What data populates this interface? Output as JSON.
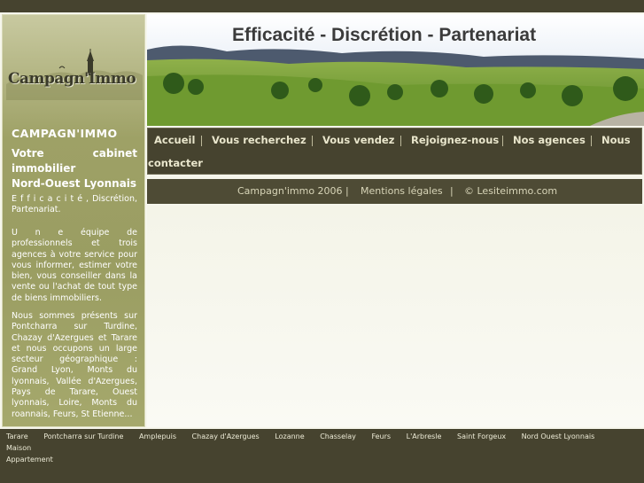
{
  "logo": {
    "text": "Campagn'Immo"
  },
  "sidebar": {
    "brand": "CAMPAGN'IMMO",
    "slogan_line1_a": "Votre",
    "slogan_line1_b": "cabinet",
    "slogan_line2": "immobilier",
    "slogan_line3": "Nord-Ouest Lyonnais",
    "p1": "E f f i c a c i t é , Discrétion, Partenariat.",
    "p2": "U n e équipe de professionnels et trois agences à votre service pour vous informer, estimer votre bien, vous conseiller dans la vente ou l'achat de tout type de biens immobiliers.",
    "p3": "Nous sommes présents sur Pontcharra sur Turdine, Chazay d'Azergues et Tarare et nous occupons un large secteur géographique : Grand Lyon, Monts du lyonnais, Vallée d'Azergues, Pays de Tarare, Ouest lyonnais, Loire, Monts du roannais, Feurs, St Etienne..."
  },
  "banner": {
    "title": "Efficacité - Discrétion - Partenariat"
  },
  "nav": {
    "items": [
      "Accueil",
      "Vous recherchez",
      "Vous vendez",
      "Rejoignez-nous",
      "Nos agences",
      "Nous",
      "contacter"
    ]
  },
  "footer": {
    "copyright": "Campagn'immo 2006",
    "sep": "|",
    "legal": "Mentions légales",
    "credit": "© Lesiteimmo.com"
  },
  "bottom_links": [
    "Tarare",
    "Pontcharra sur Turdine",
    "Amplepuis",
    "Chazay d'Azergues",
    "Lozanne",
    "Chasselay",
    "Feurs",
    "L'Arbresle",
    "Saint Forgeux",
    "Nord Ouest Lyonnais",
    "Maison",
    "Appartement"
  ]
}
